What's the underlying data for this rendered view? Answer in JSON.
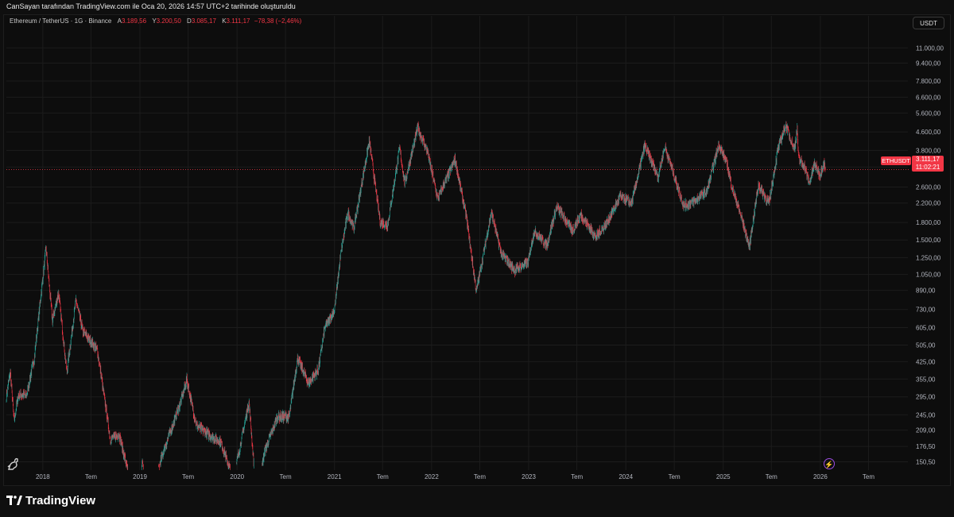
{
  "header": {
    "snapshot_text": "CanSayan tarafından TradingView.com ile Oca 20, 2026 14:57 UTC+2 tarihinde oluşturuldu"
  },
  "legend": {
    "instrument": "Ethereum / TetherUS · 1G · Binance",
    "open_label": "A",
    "open_value": "3.189,56",
    "high_label": "Y",
    "high_value": "3.200,50",
    "low_label": "D",
    "low_value": "3.085,17",
    "close_label": "K",
    "close_value": "3.111,17",
    "change": "−78,38 (−2,46%)"
  },
  "currency_button": "USDT",
  "price_tag": {
    "symbol": "ETHUSDT",
    "price": "3.111,17",
    "countdown": "11:02:21"
  },
  "footer": {
    "brand": "TradingView"
  },
  "colors": {
    "up": "#26a69a",
    "down": "#f23645",
    "background": "#0d0d0d",
    "grid": "#1c1c1c",
    "axis_text": "#b2b5be",
    "price_line": "#f23645"
  },
  "icons": [
    "dinosaur-icon",
    "lightning-icon",
    "tradingview-logo-icon"
  ],
  "chart_data": {
    "type": "candlestick",
    "y_scale": "log",
    "ylim": [
      138,
      13000
    ],
    "x_tick_labels": [
      "2018",
      "Tem",
      "2019",
      "Tem",
      "2020",
      "Tem",
      "2021",
      "Tem",
      "2022",
      "Tem",
      "2023",
      "Tem",
      "2024",
      "Tem",
      "2025",
      "Tem",
      "2026",
      "Tem"
    ],
    "x_tick_dates": [
      "2018-01-01",
      "2018-07-01",
      "2019-01-01",
      "2019-07-01",
      "2020-01-01",
      "2020-07-01",
      "2021-01-01",
      "2021-07-01",
      "2022-01-01",
      "2022-07-01",
      "2023-01-01",
      "2023-07-01",
      "2024-01-01",
      "2024-07-01",
      "2025-01-01",
      "2025-07-01",
      "2026-01-01",
      "2026-07-01"
    ],
    "xlim": [
      "2017-08-17",
      "2026-11-20"
    ],
    "y_ticks": [
      11000,
      9400,
      7800,
      6600,
      5600,
      4600,
      3800,
      3200,
      2600,
      2200,
      1800,
      1500,
      1250,
      1050,
      890,
      730,
      605,
      505,
      425,
      355,
      295,
      245,
      209,
      176.5,
      150.5
    ],
    "y_tick_labels": [
      "11.000,00",
      "9.400,00",
      "7.800,00",
      "6.600,00",
      "5.600,00",
      "4.600,00",
      "3.800,00",
      "3.200,00",
      "2.600,00",
      "2.200,00",
      "1.800,00",
      "1.500,00",
      "1.250,00",
      "1.050,00",
      "890,00",
      "730,00",
      "605,00",
      "505,00",
      "425,00",
      "355,00",
      "295,00",
      "245,00",
      "209,00",
      "176,50",
      "150,50"
    ],
    "last_price": 3111.17,
    "approx_price_path": [
      [
        "2017-08-17",
        300
      ],
      [
        "2017-09-01",
        380
      ],
      [
        "2017-09-15",
        230
      ],
      [
        "2017-10-01",
        300
      ],
      [
        "2017-11-01",
        300
      ],
      [
        "2017-12-01",
        450
      ],
      [
        "2017-12-20",
        750
      ],
      [
        "2018-01-13",
        1380
      ],
      [
        "2018-02-06",
        650
      ],
      [
        "2018-03-01",
        870
      ],
      [
        "2018-04-01",
        380
      ],
      [
        "2018-05-05",
        800
      ],
      [
        "2018-06-01",
        580
      ],
      [
        "2018-07-25",
        480
      ],
      [
        "2018-09-12",
        190
      ],
      [
        "2018-10-15",
        200
      ],
      [
        "2018-11-20",
        130
      ],
      [
        "2018-12-15",
        85
      ],
      [
        "2019-01-10",
        150
      ],
      [
        "2019-02-15",
        110
      ],
      [
        "2019-04-01",
        170
      ],
      [
        "2019-05-30",
        270
      ],
      [
        "2019-06-26",
        350
      ],
      [
        "2019-08-01",
        220
      ],
      [
        "2019-09-15",
        200
      ],
      [
        "2019-11-01",
        185
      ],
      [
        "2019-12-18",
        125
      ],
      [
        "2020-02-15",
        280
      ],
      [
        "2020-03-13",
        105
      ],
      [
        "2020-04-15",
        170
      ],
      [
        "2020-06-01",
        240
      ],
      [
        "2020-07-15",
        240
      ],
      [
        "2020-08-15",
        440
      ],
      [
        "2020-09-25",
        340
      ],
      [
        "2020-11-01",
        390
      ],
      [
        "2020-11-25",
        600
      ],
      [
        "2021-01-01",
        730
      ],
      [
        "2021-01-25",
        1300
      ],
      [
        "2021-02-20",
        2000
      ],
      [
        "2021-03-15",
        1700
      ],
      [
        "2021-05-12",
        4200
      ],
      [
        "2021-06-22",
        1800
      ],
      [
        "2021-07-20",
        1750
      ],
      [
        "2021-09-03",
        3900
      ],
      [
        "2021-09-22",
        2700
      ],
      [
        "2021-11-10",
        4800
      ],
      [
        "2021-12-15",
        3800
      ],
      [
        "2022-01-24",
        2300
      ],
      [
        "2022-03-30",
        3450
      ],
      [
        "2022-05-12",
        1900
      ],
      [
        "2022-06-18",
        880
      ],
      [
        "2022-08-14",
        2000
      ],
      [
        "2022-09-20",
        1300
      ],
      [
        "2022-11-09",
        1100
      ],
      [
        "2022-12-30",
        1190
      ],
      [
        "2023-01-21",
        1650
      ],
      [
        "2023-03-10",
        1420
      ],
      [
        "2023-04-16",
        2120
      ],
      [
        "2023-06-15",
        1650
      ],
      [
        "2023-07-15",
        1950
      ],
      [
        "2023-09-11",
        1550
      ],
      [
        "2023-10-23",
        1800
      ],
      [
        "2023-12-10",
        2350
      ],
      [
        "2024-01-23",
        2200
      ],
      [
        "2024-03-12",
        4000
      ],
      [
        "2024-05-01",
        2900
      ],
      [
        "2024-05-27",
        3950
      ],
      [
        "2024-08-05",
        2150
      ],
      [
        "2024-09-06",
        2200
      ],
      [
        "2024-11-01",
        2500
      ],
      [
        "2024-12-16",
        4050
      ],
      [
        "2025-01-15",
        3300
      ],
      [
        "2025-02-03",
        2600
      ],
      [
        "2025-03-10",
        1900
      ],
      [
        "2025-04-09",
        1400
      ],
      [
        "2025-05-13",
        2650
      ],
      [
        "2025-06-22",
        2200
      ],
      [
        "2025-07-25",
        3800
      ],
      [
        "2025-08-24",
        4950
      ],
      [
        "2025-09-25",
        3850
      ],
      [
        "2025-10-06",
        4700
      ],
      [
        "2025-10-11",
        3500
      ],
      [
        "2025-11-03",
        3200
      ],
      [
        "2025-11-21",
        2700
      ],
      [
        "2025-12-10",
        3300
      ],
      [
        "2025-12-31",
        2950
      ],
      [
        "2026-01-14",
        3350
      ],
      [
        "2026-01-20",
        3111
      ]
    ]
  }
}
